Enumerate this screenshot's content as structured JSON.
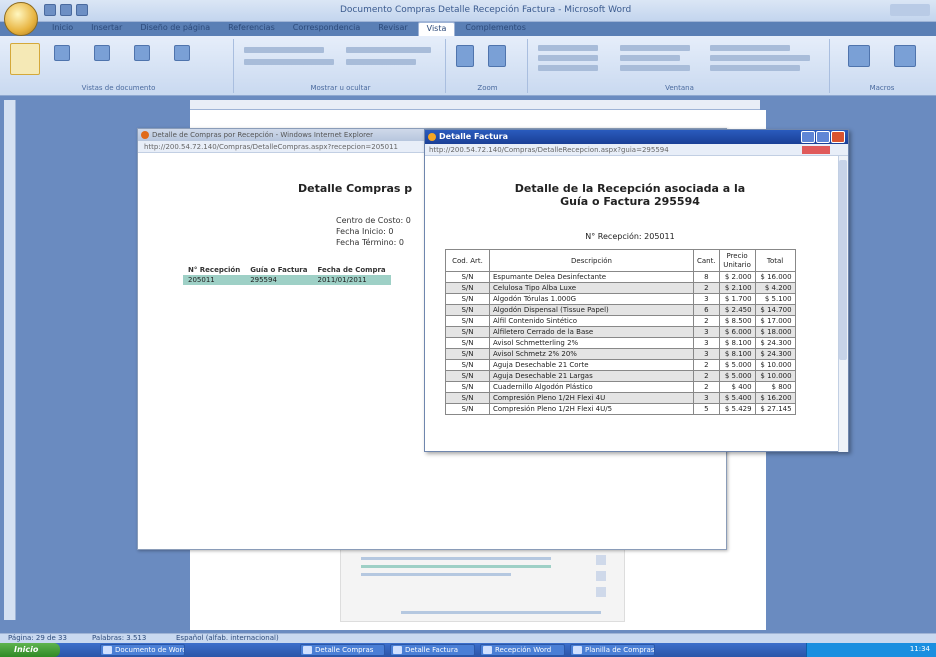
{
  "word": {
    "title": "Documento Compras Detalle Recepción Factura - Microsoft Word",
    "tabs": [
      "Inicio",
      "Insertar",
      "Diseño de página",
      "Referencias",
      "Correspondencia",
      "Revisar",
      "Vista",
      "Complementos"
    ],
    "active_tab": "Vista",
    "ribbon_groups": [
      "Vistas de documento",
      "Mostrar u ocultar",
      "Zoom",
      "Ventana",
      "Macros"
    ],
    "status": {
      "page": "Página: 29 de 33",
      "words": "Palabras: 3.513",
      "lang": "Español (alfab. internacional)"
    }
  },
  "browser1": {
    "title": "Detalle de Compras por Recepción - Windows Internet Explorer",
    "address": "http://200.54.72.140/Compras/DetalleCompras.aspx?recepcion=205011",
    "heading": "Detalle Compras p",
    "labels": [
      "Centro de Costo:",
      "Fecha Inicio:",
      "Fecha Término:"
    ],
    "values": [
      "0",
      "0",
      "0"
    ],
    "table_headers": [
      "N° Recepción",
      "Guía o Factura",
      "Fecha de Compra"
    ],
    "table_row": [
      "205011",
      "295594",
      "2011/01/2011"
    ]
  },
  "browser2": {
    "title": "Detalle Factura",
    "address": "http://200.54.72.140/Compras/DetalleRecepcion.aspx?guia=295594",
    "heading_line1": "Detalle de la Recepción asociada a la",
    "heading_line2": "Guía o Factura 295594",
    "recepcion_label": "N° Recepción: 205011",
    "headers": [
      "Cod. Art.",
      "Descripción",
      "Cant.",
      "Precio Unitario",
      "Total"
    ],
    "rows": [
      [
        "S/N",
        "Espumante Delea Desinfectante",
        "8",
        "$ 2.000",
        "$ 16.000"
      ],
      [
        "S/N",
        "Celulosa Tipo Alba Luxe",
        "2",
        "$ 2.100",
        "$ 4.200"
      ],
      [
        "S/N",
        "Algodón Tórulas 1.000G",
        "3",
        "$ 1.700",
        "$ 5.100"
      ],
      [
        "S/N",
        "Algodón Dispensal (Tissue Papel)",
        "6",
        "$ 2.450",
        "$ 14.700"
      ],
      [
        "S/N",
        "Alfil Contenido Sintético",
        "2",
        "$ 8.500",
        "$ 17.000"
      ],
      [
        "S/N",
        "Alfiletero Cerrado de la Base",
        "3",
        "$ 6.000",
        "$ 18.000"
      ],
      [
        "S/N",
        "Avisol Schmetterling 2%",
        "3",
        "$ 8.100",
        "$ 24.300"
      ],
      [
        "S/N",
        "Avisol Schmetz 2% 20%",
        "3",
        "$ 8.100",
        "$ 24.300"
      ],
      [
        "S/N",
        "Aguja Desechable 21 Corte",
        "2",
        "$ 5.000",
        "$ 10.000"
      ],
      [
        "S/N",
        "Aguja Desechable 21 Largas",
        "2",
        "$ 5.000",
        "$ 10.000"
      ],
      [
        "S/N",
        "Cuadernillo Algodón Plástico",
        "2",
        "$ 400",
        "$ 800"
      ],
      [
        "S/N",
        "Compresión Pleno 1/2H Flexi 4U",
        "3",
        "$ 5.400",
        "$ 16.200"
      ],
      [
        "S/N",
        "Compresión Pleno 1/2H Flexi 4U/5",
        "5",
        "$ 5.429",
        "$ 27.145"
      ]
    ]
  },
  "taskbar": {
    "start": "Inicio",
    "tasks": [
      "Documento de Word",
      "Detalle Compras",
      "Detalle Factura",
      "Recepción Word",
      "Planilla de Compras"
    ],
    "clock": "11:34"
  }
}
